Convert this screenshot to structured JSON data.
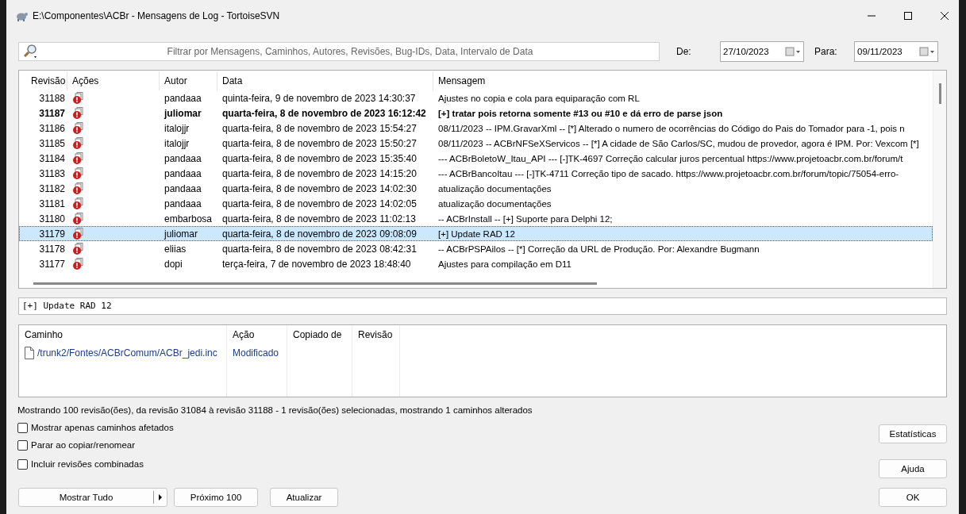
{
  "window": {
    "title": "E:\\Componentes\\ACBr - Mensagens de Log - TortoiseSVN"
  },
  "filter": {
    "placeholder": "Filtrar por Mensagens, Caminhos, Autores, Revisões, Bug-IDs, Data, Intervalo de Data",
    "from_label": "De:",
    "from_value": "27/10/2023",
    "to_label": "Para:",
    "to_value": "09/11/2023"
  },
  "log": {
    "columns": [
      "Revisão",
      "Ações",
      "Autor",
      "Data",
      "Mensagem"
    ],
    "rows": [
      {
        "revision": "31188",
        "author": "pandaaa",
        "date": "quinta-feira, 9 de novembro de 2023 14:30:37",
        "message": "Ajustes no copia e cola para equiparação com RL",
        "current": false,
        "selected": false
      },
      {
        "revision": "31187",
        "author": "juliomar",
        "date": "quarta-feira, 8 de novembro de 2023 16:12:42",
        "message": "[+] tratar pois retorna somente #13 ou #10 e dá erro de parse json",
        "current": true,
        "selected": false
      },
      {
        "revision": "31186",
        "author": "italojjr",
        "date": "quarta-feira, 8 de novembro de 2023 15:54:27",
        "message": "08/11/2023 -- IPM.GravarXml -- [*] Alterado o numero de ocorrências do Código do Pais do Tomador para -1,     pois n",
        "current": false,
        "selected": false
      },
      {
        "revision": "31185",
        "author": "italojjr",
        "date": "quarta-feira, 8 de novembro de 2023 15:50:27",
        "message": "08/11/2023 -- ACBrNFSeXServicos -- [*] A cidade de São Carlos/SC, mudou de provedor, agora é IPM.   Por: Vexcom [*]",
        "current": false,
        "selected": false
      },
      {
        "revision": "31184",
        "author": "pandaaa",
        "date": "quarta-feira, 8 de novembro de 2023 15:35:40",
        "message": "--- ACBrBoletoW_Itau_API --- [-]TK-4697 Correção calcular juros percentual https://www.projetoacbr.com.br/forum/t",
        "current": false,
        "selected": false
      },
      {
        "revision": "31183",
        "author": "pandaaa",
        "date": "quarta-feira, 8 de novembro de 2023 14:15:20",
        "message": "--- ACBrBancoItau --- [-]TK-4711 Correção tipo de sacado. https://www.projetoacbr.com.br/forum/topic/75054-erro-",
        "current": false,
        "selected": false
      },
      {
        "revision": "31182",
        "author": "pandaaa",
        "date": "quarta-feira, 8 de novembro de 2023 14:02:30",
        "message": "atualização documentações",
        "current": false,
        "selected": false
      },
      {
        "revision": "31181",
        "author": "pandaaa",
        "date": "quarta-feira, 8 de novembro de 2023 14:02:05",
        "message": "atualização documentações",
        "current": false,
        "selected": false
      },
      {
        "revision": "31180",
        "author": "embarbosa",
        "date": "quarta-feira, 8 de novembro de 2023 11:02:13",
        "message": "-- ACBrInstall -- [+] Suporte para Delphi 12;",
        "current": false,
        "selected": false
      },
      {
        "revision": "31179",
        "author": "juliomar",
        "date": "quarta-feira, 8 de novembro de 2023 09:08:09",
        "message": "[+] Update RAD 12",
        "current": false,
        "selected": true
      },
      {
        "revision": "31178",
        "author": "eliias",
        "date": "quarta-feira, 8 de novembro de 2023 08:42:31",
        "message": "-- ACBrPSPAilos -- [*] Correção da URL de Produção.     Por: Alexandre Bugmann",
        "current": false,
        "selected": false
      },
      {
        "revision": "31177",
        "author": "dopi",
        "date": "terça-feira, 7 de novembro de 2023 18:48:40",
        "message": "Ajustes para compilação em D11",
        "current": false,
        "selected": false
      }
    ]
  },
  "commit_message": "[+] Update RAD 12",
  "paths": {
    "columns": [
      "Caminho",
      "Ação",
      "Copiado de",
      "Revisão"
    ],
    "rows": [
      {
        "path": "/trunk2/Fontes/ACBrComum/ACBr_jedi.inc",
        "action": "Modificado"
      }
    ]
  },
  "status": "Mostrando 100 revisão(ões), da revisão 31084 à revisão 31188 - 1 revisão(ões) selecionadas, mostrando 1 caminhos alterados",
  "options": [
    {
      "label": "Mostrar apenas caminhos afetados",
      "checked": false
    },
    {
      "label": "Parar ao copiar/renomear",
      "checked": false
    },
    {
      "label": "Incluir revisões combinadas",
      "checked": false
    }
  ],
  "buttons": {
    "show_all": "Mostrar Tudo",
    "next": "Próximo 100",
    "refresh": "Atualizar",
    "statistics": "Estatísticas",
    "help": "Ajuda",
    "ok": "OK"
  }
}
